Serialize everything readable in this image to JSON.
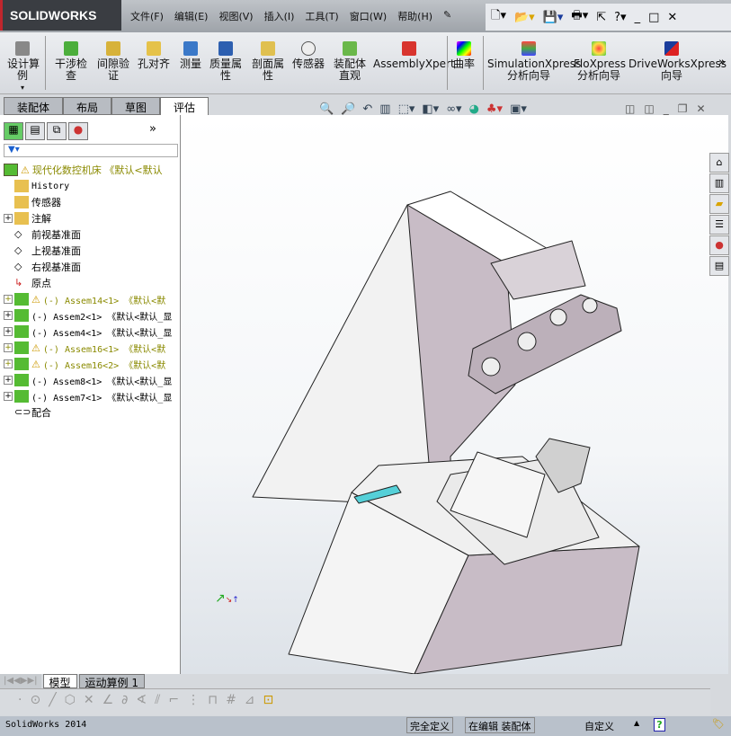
{
  "app": {
    "logo": "SOLIDWORKS"
  },
  "menu": [
    "文件(F)",
    "编辑(E)",
    "视图(V)",
    "插入(I)",
    "工具(T)",
    "窗口(W)",
    "帮助(H)"
  ],
  "commands": [
    {
      "label": "设计算\n例",
      "icon": "design-study-icon"
    },
    {
      "label": "干涉检\n查",
      "icon": "interference-icon"
    },
    {
      "label": "间隙验\n证",
      "icon": "clearance-icon"
    },
    {
      "label": "孔对齐",
      "icon": "hole-align-icon"
    },
    {
      "label": "测量",
      "icon": "measure-icon"
    },
    {
      "label": "质量属\n性",
      "icon": "mass-props-icon"
    },
    {
      "label": "剖面属\n性",
      "icon": "section-props-icon"
    },
    {
      "label": "传感器",
      "icon": "sensor-icon"
    },
    {
      "label": "装配体\n直观",
      "icon": "assembly-visual-icon"
    },
    {
      "label": "AssemblyXpert",
      "icon": "assemblyxpert-icon"
    },
    {
      "label": "曲率",
      "icon": "curvature-icon"
    },
    {
      "label": "SimulationXpress\n分析向导",
      "icon": "simulation-icon"
    },
    {
      "label": "FloXpress\n分析向导",
      "icon": "floxpress-icon"
    },
    {
      "label": "DriveWorksXpress\n向导",
      "icon": "driveworks-icon"
    }
  ],
  "tabs": [
    "装配体",
    "布局",
    "草图",
    "评估"
  ],
  "active_tab": "评估",
  "tree": {
    "root": "现代化数控机床  《默认<默认",
    "items": [
      {
        "label": "History",
        "mono": true
      },
      {
        "label": "传感器"
      },
      {
        "label": "注解",
        "expand": true
      },
      {
        "label": "前视基准面"
      },
      {
        "label": "上视基准面"
      },
      {
        "label": "右视基准面"
      },
      {
        "label": "原点"
      },
      {
        "label": "(-) Assem14<1> 《默认<默",
        "expand": true,
        "warn": true
      },
      {
        "label": "(-) Assem2<1> 《默认<默认_显",
        "expand": true
      },
      {
        "label": "(-) Assem4<1> 《默认<默认_显",
        "expand": true
      },
      {
        "label": "(-) Assem16<1> 《默认<默",
        "expand": true,
        "warn": true
      },
      {
        "label": "(-) Assem16<2> 《默认<默",
        "expand": true,
        "warn": true
      },
      {
        "label": "(-) Assem8<1> 《默认<默认_显",
        "expand": true
      },
      {
        "label": "(-) Assem7<1> 《默认<默认_显",
        "expand": true
      },
      {
        "label": "配合"
      }
    ]
  },
  "bottom_tabs": [
    "模型",
    "运动算例 1"
  ],
  "status": {
    "app": "SolidWorks 2014",
    "defined": "完全定义",
    "editing": "在编辑 装配体",
    "units": "自定义",
    "help": "?"
  },
  "colors": {
    "accent": "#c0262d",
    "viewport_top": "#ffffff",
    "model_body": "#c8bcc6"
  }
}
